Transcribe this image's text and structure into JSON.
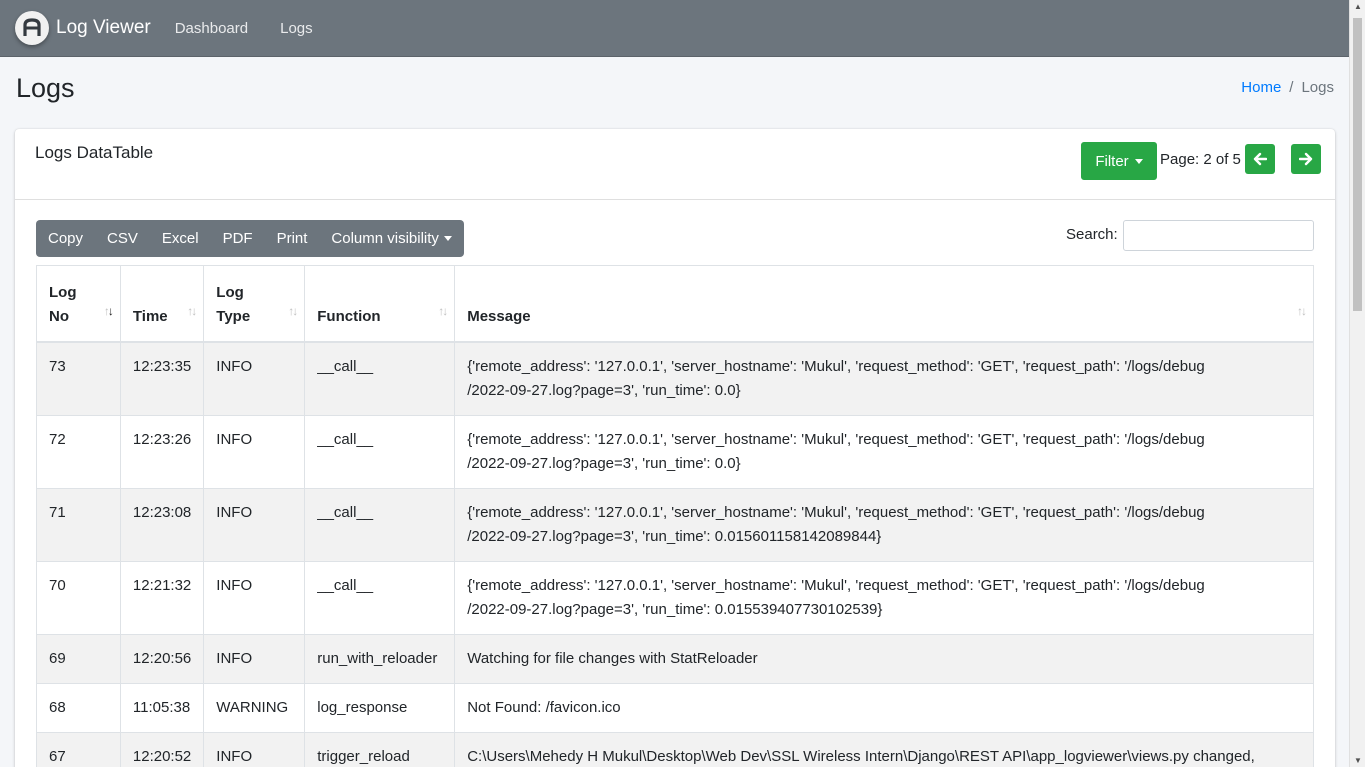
{
  "app": {
    "name": "Log Viewer",
    "logo_letter": "A"
  },
  "nav": {
    "items": [
      "Dashboard",
      "Logs"
    ]
  },
  "page": {
    "title": "Logs"
  },
  "breadcrumb": {
    "home": "Home",
    "separator": "/",
    "current": "Logs"
  },
  "card": {
    "title": "Logs DataTable",
    "filter_label": "Filter",
    "page_info": "Page: 2 of 5",
    "prev_icon": "arrow-left-icon",
    "next_icon": "arrow-right-icon"
  },
  "toolbar": {
    "buttons": [
      "Copy",
      "CSV",
      "Excel",
      "PDF",
      "Print"
    ],
    "column_visibility": "Column visibility"
  },
  "search": {
    "label": "Search:",
    "value": ""
  },
  "table": {
    "headers": [
      {
        "line1": "Log",
        "line2": "No"
      },
      {
        "line1": "",
        "line2": "Time"
      },
      {
        "line1": "Log",
        "line2": "Type"
      },
      {
        "line1": "",
        "line2": "Function"
      },
      {
        "line1": "",
        "line2": "Message"
      }
    ],
    "rows": [
      {
        "no": "73",
        "time": "12:23:35",
        "type": "INFO",
        "func": "__call__",
        "msg1": "{'remote_address': '127.0.0.1', 'server_hostname': 'Mukul', 'request_method': 'GET', 'request_path': '/logs/debug",
        "msg2": "/2022-09-27.log?page=3', 'run_time': 0.0}"
      },
      {
        "no": "72",
        "time": "12:23:26",
        "type": "INFO",
        "func": "__call__",
        "msg1": "{'remote_address': '127.0.0.1', 'server_hostname': 'Mukul', 'request_method': 'GET', 'request_path': '/logs/debug",
        "msg2": "/2022-09-27.log?page=3', 'run_time': 0.0}"
      },
      {
        "no": "71",
        "time": "12:23:08",
        "type": "INFO",
        "func": "__call__",
        "msg1": "{'remote_address': '127.0.0.1', 'server_hostname': 'Mukul', 'request_method': 'GET', 'request_path': '/logs/debug",
        "msg2": "/2022-09-27.log?page=3', 'run_time': 0.015601158142089844}"
      },
      {
        "no": "70",
        "time": "12:21:32",
        "type": "INFO",
        "func": "__call__",
        "msg1": "{'remote_address': '127.0.0.1', 'server_hostname': 'Mukul', 'request_method': 'GET', 'request_path': '/logs/debug",
        "msg2": "/2022-09-27.log?page=3', 'run_time': 0.015539407730102539}"
      },
      {
        "no": "69",
        "time": "12:20:56",
        "type": "INFO",
        "func": "run_with_reloader",
        "msg1": "Watching for file changes with StatReloader",
        "msg2": ""
      },
      {
        "no": "68",
        "time": "11:05:38",
        "type": "WARNING",
        "func": "log_response",
        "msg1": "Not Found: /favicon.ico",
        "msg2": ""
      },
      {
        "no": "67",
        "time": "12:20:52",
        "type": "INFO",
        "func": "trigger_reload",
        "msg1": "C:\\Users\\Mehedy H Mukul\\Desktop\\Web Dev\\SSL Wireless Intern\\Django\\REST API\\app_logviewer\\views.py changed,",
        "msg2": ""
      }
    ]
  }
}
